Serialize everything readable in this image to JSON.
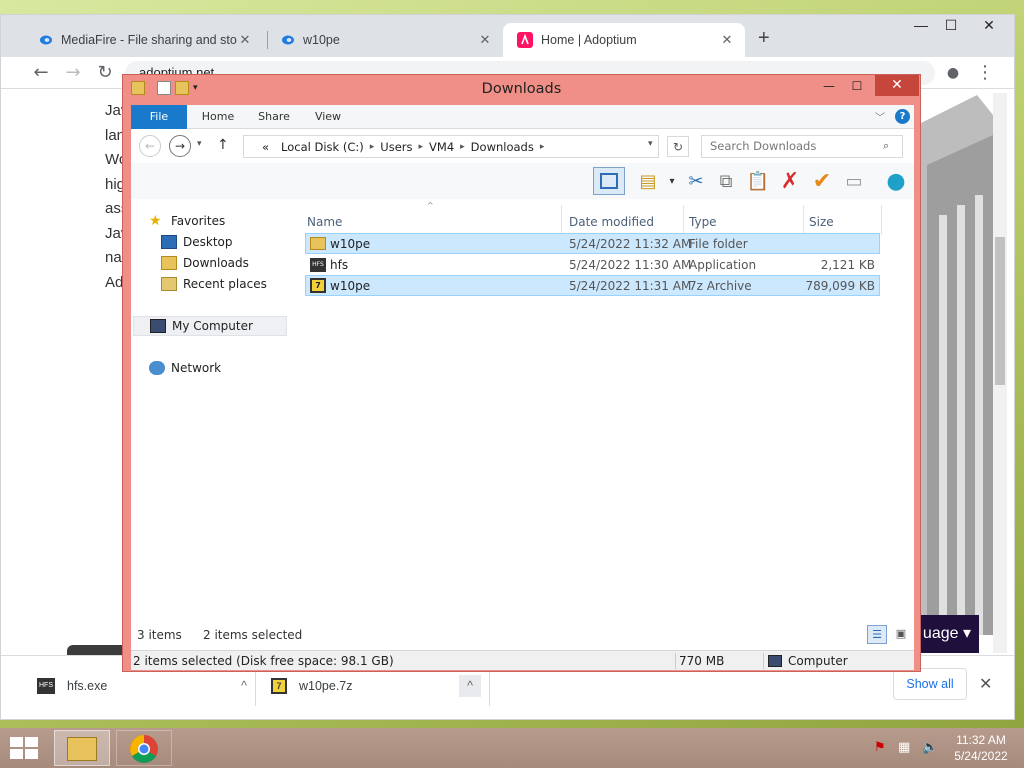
{
  "browser": {
    "tabs": [
      {
        "title": "MediaFire - File sharing and stora",
        "close": "✕"
      },
      {
        "title": "w10pe",
        "close": "✕"
      },
      {
        "title": "Home | Adoptium",
        "close": "✕"
      }
    ],
    "new_tab": "+",
    "window_controls": {
      "minimize": "—",
      "maximize": "☐",
      "close": "✕"
    },
    "address": "adoptium.net",
    "page_text_fragments": [
      "Jav",
      "lan",
      "Wo",
      "hig",
      "ass",
      "Jav",
      "na",
      "Ad"
    ],
    "language_button": "uage ▾",
    "downloads": [
      {
        "name": "hfs.exe",
        "chevron": "^",
        "icon": "hfs-exe-icon"
      },
      {
        "name": "w10pe.7z",
        "chevron": "^",
        "icon": "archive-icon"
      }
    ],
    "show_all": "Show all",
    "close_bar": "✕"
  },
  "explorer": {
    "title": "Downloads",
    "controls": {
      "minimize": "—",
      "maximize": "☐",
      "close": "✕"
    },
    "ribbon_tabs": [
      "File",
      "Home",
      "Share",
      "View"
    ],
    "address_path": [
      "«",
      "Local Disk (C:)",
      "Users",
      "VM4",
      "Downloads"
    ],
    "search_placeholder": "Search Downloads",
    "nav": {
      "favorites": "Favorites",
      "desktop": "Desktop",
      "downloads": "Downloads",
      "recent": "Recent places",
      "computer": "My Computer",
      "network": "Network"
    },
    "columns": [
      "Name",
      "Date modified",
      "Type",
      "Size"
    ],
    "files": [
      {
        "name": "w10pe",
        "date": "5/24/2022 11:32 AM",
        "type": "File folder",
        "size": "",
        "selected": true
      },
      {
        "name": "hfs",
        "date": "5/24/2022 11:30 AM",
        "type": "Application",
        "size": "2,121 KB",
        "selected": false
      },
      {
        "name": "w10pe",
        "date": "5/24/2022 11:31 AM",
        "type": "7z Archive",
        "size": "789,099 KB",
        "selected": true
      }
    ],
    "item_count": "3 items",
    "selected_count": "2 items selected",
    "status_left": "2 items selected (Disk free space: 98.1 GB)",
    "status_size": "770 MB",
    "status_location": "Computer"
  },
  "taskbar": {
    "time": "11:32 AM",
    "date": "5/24/2022"
  },
  "colors": {
    "explorer_frame": "#ef8f87",
    "close_button": "#c7463b",
    "selection": "#cce8ff",
    "ribbon_file": "#1979ca"
  }
}
